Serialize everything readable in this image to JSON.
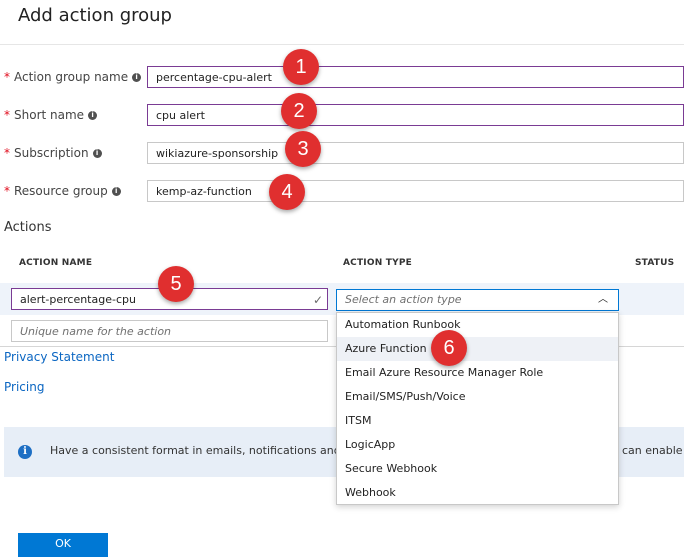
{
  "blade": {
    "title": "Add action group"
  },
  "fields": {
    "action_group_name": {
      "label": "Action group name",
      "value": "percentage-cpu-alert"
    },
    "short_name": {
      "label": "Short name",
      "value": "cpu alert"
    },
    "subscription": {
      "label": "Subscription",
      "value": "wikiazure-sponsorship"
    },
    "resource_group": {
      "label": "Resource group",
      "value": "kemp-az-function"
    }
  },
  "actions": {
    "section_label": "Actions",
    "columns": {
      "name": "ACTION NAME",
      "type": "ACTION TYPE",
      "status": "STATUS"
    },
    "row": {
      "name": "alert-percentage-cpu"
    },
    "type_placeholder": "Select an action type",
    "new_name_placeholder": "Unique name for the action",
    "type_options": [
      "Automation Runbook",
      "Azure Function",
      "Email Azure Resource Manager Role",
      "Email/SMS/Push/Voice",
      "ITSM",
      "LogicApp",
      "Secure Webhook",
      "Webhook"
    ],
    "hovered_option": "Azure Function"
  },
  "links": {
    "privacy": "Privacy Statement",
    "pricing": "Pricing"
  },
  "info_banner": {
    "text_left": "Have a consistent format in emails, notifications and o",
    "text_right": "can enable p"
  },
  "footer": {
    "ok_label": "OK"
  },
  "annotations": [
    "1",
    "2",
    "3",
    "4",
    "5",
    "6"
  ],
  "colors": {
    "accent": "#0078d4",
    "focus_border": "#7a3b94",
    "required": "#e00b1c",
    "badge": "#e02f2f"
  }
}
